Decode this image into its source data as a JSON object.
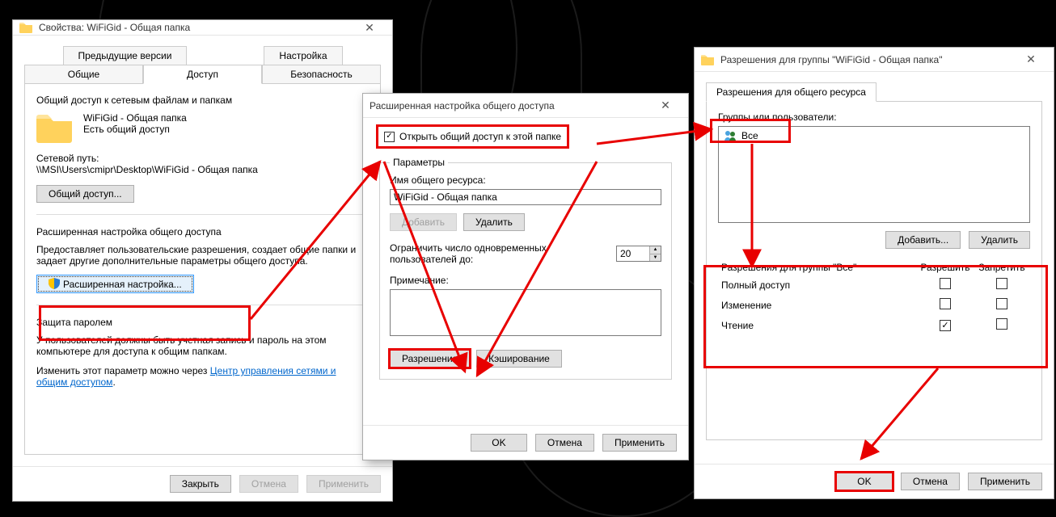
{
  "props": {
    "title": "Свойства: WiFiGid - Общая папка",
    "tabs_row1": [
      "Предыдущие версии",
      "Настройка"
    ],
    "tabs_row2": [
      "Общие",
      "Доступ",
      "Безопасность"
    ],
    "share_heading": "Общий доступ к сетевым файлам и папкам",
    "folder_name": "WiFiGid - Общая папка",
    "share_status": "Есть общий доступ",
    "netpath_label": "Сетевой путь:",
    "netpath_value": "\\\\MSI\\Users\\cmipr\\Desktop\\WiFiGid - Общая папка",
    "share_btn": "Общий доступ...",
    "adv_heading": "Расширенная настройка общего доступа",
    "adv_desc": "Предоставляет пользовательские разрешения, создает общие папки и задает другие дополнительные параметры общего доступа.",
    "adv_btn": "Расширенная настройка...",
    "pwd_heading": "Защита паролем",
    "pwd_desc": "У пользователей должны быть учетная запись и пароль на этом компьютере для доступа к общим папкам.",
    "pwd_link_prefix": "Изменить этот параметр можно через ",
    "pwd_link": "Центр управления сетями и общим доступом",
    "btn_close": "Закрыть",
    "btn_cancel": "Отмена",
    "btn_apply": "Применить"
  },
  "adv": {
    "title": "Расширенная настройка общего доступа",
    "chk_label": "Открыть общий доступ к этой папке",
    "chk_checked": true,
    "group_label": "Параметры",
    "name_label": "Имя общего ресурса:",
    "name_value": "WiFiGid - Общая папка",
    "btn_add": "Добавить",
    "btn_remove": "Удалить",
    "limit_label": "Ограничить число одновременных пользователей до:",
    "limit_value": "20",
    "note_label": "Примечание:",
    "note_value": "",
    "btn_perm": "Разрешения",
    "btn_cache": "Кэширование",
    "btn_ok": "OK",
    "btn_cancel": "Отмена",
    "btn_apply": "Применить"
  },
  "perm": {
    "title": "Разрешения для группы \"WiFiGid - Общая папка\"",
    "tab": "Разрешения для общего ресурса",
    "groups_label": "Группы или пользователи:",
    "items": [
      {
        "name": "Все"
      }
    ],
    "btn_add": "Добавить...",
    "btn_remove": "Удалить",
    "table_header": "Разрешения для группы \"Все\"",
    "col_allow": "Разрешить",
    "col_deny": "Запретить",
    "rows": [
      {
        "label": "Полный доступ",
        "allow": false,
        "deny": false
      },
      {
        "label": "Изменение",
        "allow": false,
        "deny": false
      },
      {
        "label": "Чтение",
        "allow": true,
        "deny": false
      }
    ],
    "btn_ok": "OK",
    "btn_cancel": "Отмена",
    "btn_apply": "Применить"
  }
}
